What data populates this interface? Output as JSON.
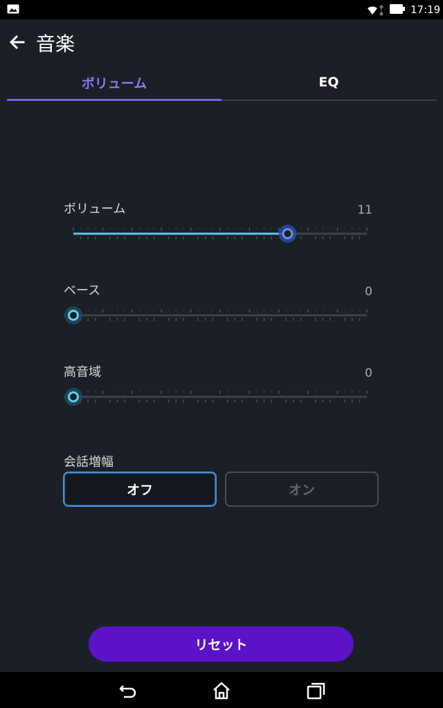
{
  "status_bar": {
    "time": "17:19",
    "icons": [
      "picture-icon",
      "wifi-icon",
      "battery-icon"
    ]
  },
  "header": {
    "title": "音楽",
    "back_icon": "back-arrow-icon"
  },
  "tabs": [
    {
      "label": "ボリューム",
      "selected": true
    },
    {
      "label": "EQ",
      "selected": false
    }
  ],
  "sliders": [
    {
      "label": "ボリューム",
      "value_text": "11",
      "fraction": 0.73
    },
    {
      "label": "ベース",
      "value_text": "0",
      "fraction": 0.0
    },
    {
      "label": "高音域",
      "value_text": "0",
      "fraction": 0.0
    }
  ],
  "conversation_boost": {
    "label": "会話増幅",
    "off_label": "オフ",
    "on_label": "オン",
    "selected": "off"
  },
  "reset_label": "リセット",
  "nav_bar": {
    "icons": [
      "back-icon",
      "home-icon",
      "recent-apps-icon"
    ]
  },
  "colors": {
    "background": "#1b1f26",
    "accent": "#7b5fe0",
    "slider_fill": "#5fc7f0",
    "reset_button": "#5c12c7"
  }
}
